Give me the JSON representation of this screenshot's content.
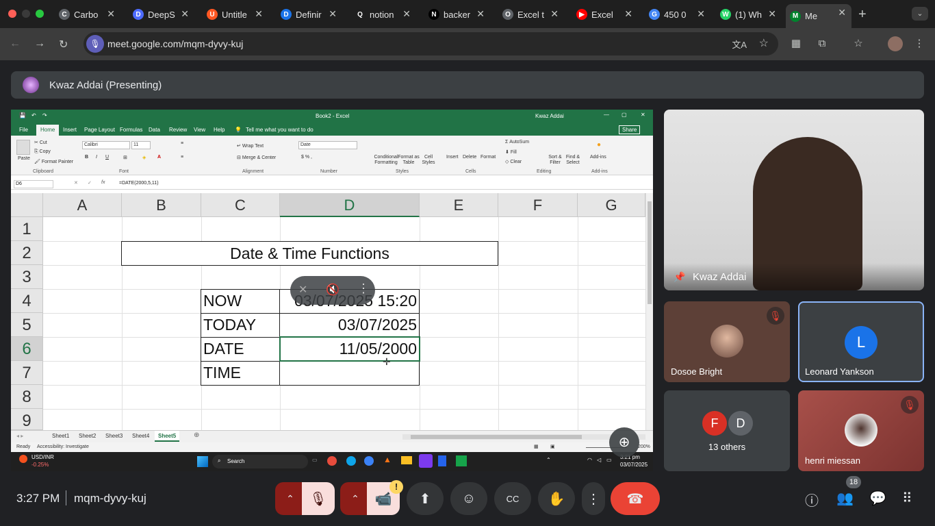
{
  "browser": {
    "tabs": [
      {
        "title": "Carbo",
        "fav_color": "#5f6368",
        "fav": "C"
      },
      {
        "title": "DeepS",
        "fav_color": "#4d6bfe",
        "fav": "D"
      },
      {
        "title": "Untitle",
        "fav_color": "#ff5722",
        "fav": "U"
      },
      {
        "title": "Definir",
        "fav_color": "#1a73e8",
        "fav": "D"
      },
      {
        "title": "notion",
        "fav_color": "#1f1f1f",
        "fav": "Q"
      },
      {
        "title": "backer",
        "fav_color": "#000000",
        "fav": "N"
      },
      {
        "title": "Excel t",
        "fav_color": "#5f6368",
        "fav": "O"
      },
      {
        "title": "Excel",
        "fav_color": "#ff0000",
        "fav": "▶"
      },
      {
        "title": "450 0",
        "fav_color": "#4285f4",
        "fav": "G"
      },
      {
        "title": "(1) Wh",
        "fav_color": "#25d366",
        "fav": "W"
      },
      {
        "title": "Me",
        "fav_color": "#00832d",
        "fav": "M"
      }
    ],
    "url": "meet.google.com/mqm-dyvy-kuj",
    "icons": {
      "back": "←",
      "forward": "→",
      "reload": "↻",
      "new_tab": "+",
      "menu": "⋮"
    }
  },
  "meet": {
    "presenting_label": "Kwaz Addai (Presenting)",
    "time": "3:27 PM",
    "meeting_code": "mqm-dyvy-kuj",
    "participants_count": "18",
    "participants": [
      {
        "name": "Kwaz Addai",
        "pinned": true
      },
      {
        "name": "Dosoe Bright",
        "muted": true
      },
      {
        "name": "Leonard Yankson",
        "initial": "L",
        "avatar_color": "#1a73e8"
      },
      {
        "name": "13 others",
        "initials": [
          "F",
          "D"
        ],
        "colors": [
          "#d93025",
          "#5f6368"
        ]
      },
      {
        "name": "henri miessan",
        "muted": true
      }
    ],
    "warning_badge": "!"
  },
  "excel": {
    "title_book": "Book2 - Excel",
    "user": "Kwaz Addai",
    "ribbon_tabs": [
      "File",
      "Home",
      "Insert",
      "Page Layout",
      "Formulas",
      "Data",
      "Review",
      "View",
      "Help"
    ],
    "tell_me": "Tell me what you want to do",
    "share": "Share",
    "clipboard": {
      "cut": "Cut",
      "copy": "Copy",
      "format_painter": "Format Painter",
      "paste": "Paste",
      "group": "Clipboard"
    },
    "font": {
      "name": "Calibri",
      "size": "11",
      "group": "Font"
    },
    "alignment": {
      "wrap": "Wrap Text",
      "merge": "Merge & Center",
      "group": "Alignment"
    },
    "number": {
      "format": "Date",
      "group": "Number"
    },
    "styles": {
      "cond": "Conditional Formatting",
      "table": "Format as Table",
      "cell": "Cell Styles",
      "group": "Styles"
    },
    "cells": {
      "insert": "Insert",
      "delete": "Delete",
      "format": "Format",
      "group": "Cells"
    },
    "editing": {
      "autosum": "AutoSum",
      "fill": "Fill",
      "clear": "Clear",
      "sort": "Sort & Filter",
      "find": "Find & Select",
      "group": "Editing"
    },
    "addins": {
      "label": "Add-ins",
      "group": "Add-ins"
    },
    "name_box": "D6",
    "formula": "=DATE(2000,5,11)",
    "columns": [
      "A",
      "B",
      "C",
      "D",
      "E",
      "F",
      "G"
    ],
    "rows": [
      "1",
      "2",
      "3",
      "4",
      "5",
      "6",
      "7",
      "8",
      "9"
    ],
    "heading": "Date & Time Functions",
    "table": [
      {
        "label": "NOW",
        "value": "03/07/2025 15:20"
      },
      {
        "label": "TODAY",
        "value": "03/07/2025"
      },
      {
        "label": "DATE",
        "value": "11/05/2000"
      },
      {
        "label": "TIME",
        "value": ""
      }
    ],
    "sheets": [
      "Sheet1",
      "Sheet2",
      "Sheet3",
      "Sheet4",
      "Sheet5"
    ],
    "active_sheet": "Sheet5",
    "status_ready": "Ready",
    "status_access": "Accessibility: Investigate",
    "zoom": "200%"
  },
  "taskbar": {
    "ticker": "USD/INR",
    "ticker_change": "-0.25%",
    "search": "Search",
    "clock_time": "3:21 pm",
    "clock_date": "03/07/2025"
  }
}
